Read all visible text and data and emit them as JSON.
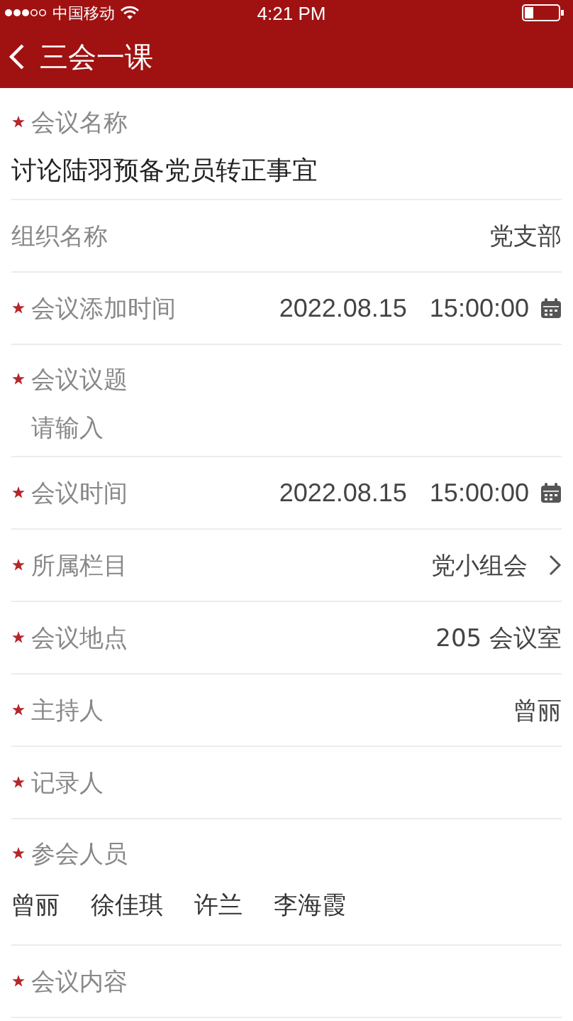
{
  "status_bar": {
    "carrier": "中国移动",
    "time": "4:21 PM"
  },
  "nav": {
    "title": "三会一课"
  },
  "fields": [
    {
      "kind": "stacked",
      "label": "会议名称",
      "required": true,
      "value": "讨论陆羽预备党员转正事宜"
    },
    {
      "kind": "text",
      "label": "组织名称",
      "required": false,
      "value": "党支部"
    },
    {
      "kind": "date",
      "label": "会议添加时间",
      "required": true,
      "date": "2022.08.15",
      "time": "15:00:00"
    },
    {
      "kind": "stacked",
      "label": "会议议题",
      "required": true,
      "placeholder": "请输入"
    },
    {
      "kind": "date",
      "label": "会议时间",
      "required": true,
      "date": "2022.08.15",
      "time": "15:00:00"
    },
    {
      "kind": "select",
      "label": "所属栏目",
      "required": true,
      "value": "党小组会"
    },
    {
      "kind": "text",
      "label": "会议地点",
      "required": true,
      "value": "205 会议室"
    },
    {
      "kind": "text",
      "label": "主持人",
      "required": true,
      "value": "曾丽"
    },
    {
      "kind": "text",
      "label": "记录人",
      "required": true
    },
    {
      "kind": "people",
      "label": "参会人员",
      "required": true,
      "people": [
        "曾丽",
        "徐佳琪",
        "许兰",
        "李海霞"
      ]
    },
    {
      "kind": "text",
      "label": "会议内容",
      "required": true
    }
  ]
}
